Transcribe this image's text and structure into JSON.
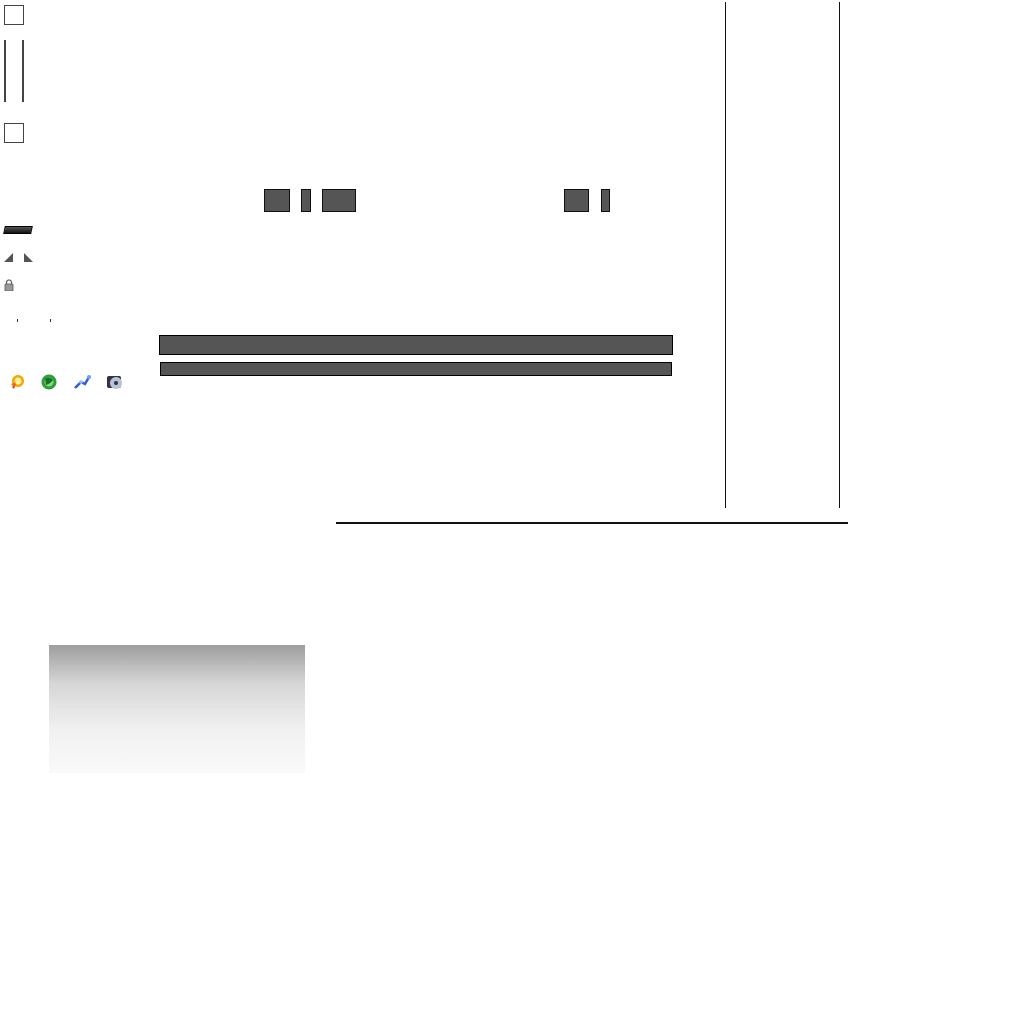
{
  "colors": {
    "block_fill": "#555555",
    "line": "#111111",
    "panel_gradient_top": "#9e9e9e",
    "panel_gradient_bottom": "#fafafa"
  },
  "sprites": {
    "checkboxes": [
      "checkbox-unchecked",
      "checkbox-unchecked"
    ],
    "icons": [
      "arrow-up-left-icon",
      "arrow-up-right-icon",
      "lock-icon",
      "burst-icon",
      "globe-icon",
      "network-icon",
      "disc-icon"
    ]
  },
  "panels": {
    "top_buttons": [
      "gray-block",
      "gray-block",
      "gray-block",
      "gray-block",
      "gray-block"
    ],
    "wide_bars": [
      "gray-bar",
      "gray-bar"
    ]
  }
}
